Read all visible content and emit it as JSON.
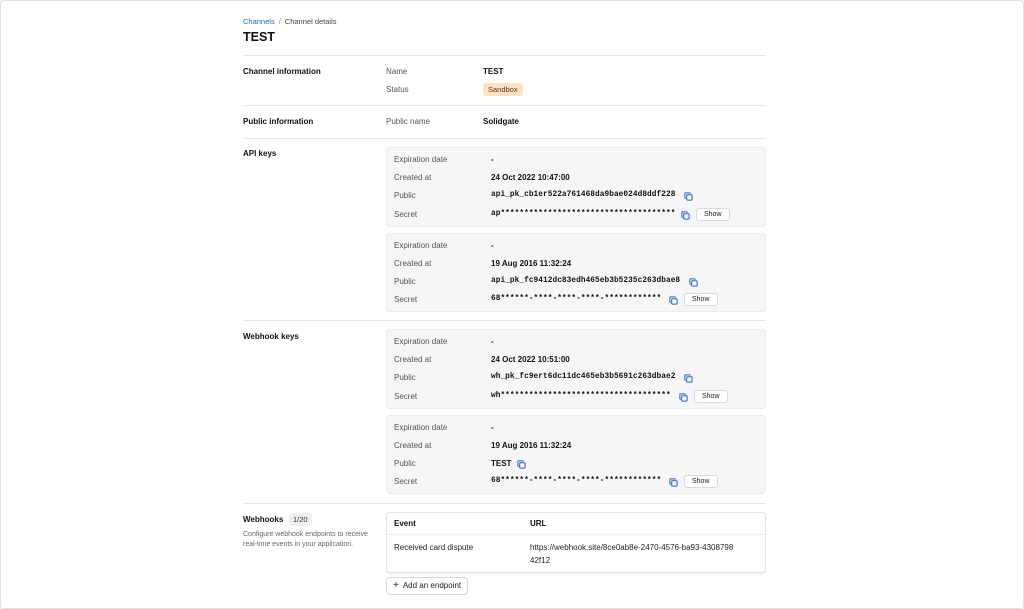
{
  "breadcrumb": {
    "root": "Channels",
    "current": "Channel details"
  },
  "page_title": "TEST",
  "channel_info": {
    "title": "Channel information",
    "name_label": "Name",
    "name_value": "TEST",
    "status_label": "Status",
    "status_value": "Sandbox"
  },
  "public_info": {
    "title": "Public information",
    "public_name_label": "Public name",
    "public_name_value": "Solidgate"
  },
  "labels": {
    "expiration": "Expiration date",
    "created": "Created at",
    "public": "Public",
    "secret": "Secret",
    "show": "Show"
  },
  "api_keys": {
    "title": "API keys",
    "keys": [
      {
        "expiration": "-",
        "created": "24 Oct 2022 10:47:00",
        "public": "api_pk_cb1er522a761468da9bae024d8ddf228",
        "secret": "ap*************************************"
      },
      {
        "expiration": "-",
        "created": "19 Aug 2016 11:32:24",
        "public": "api_pk_fc9412dc83edh465eb3b5235c263dbae8",
        "secret": "68******-****-****-****-************"
      }
    ]
  },
  "webhook_keys": {
    "title": "Webhook keys",
    "keys": [
      {
        "expiration": "-",
        "created": "24 Oct 2022 10:51:00",
        "public": "wh_pk_fc9ert6dc11dc465eb3b5691c263dbae2",
        "secret": "wh************************************"
      },
      {
        "expiration": "-",
        "created": "19 Aug 2016 11:32:24",
        "public": "TEST",
        "secret": "68******-****-****-****-************"
      }
    ]
  },
  "webhooks": {
    "title": "Webhooks",
    "count": "1/20",
    "description": "Configure webhook endpoints to receive real-time events in your application.",
    "columns": [
      "Event",
      "URL"
    ],
    "rows": [
      {
        "event": "Received card dispute",
        "url": "https://webhook.site/8ce0ab8e-2470-4576-ba93-430879842f12"
      }
    ],
    "add_label": "Add an endpoint"
  },
  "colors": {
    "link": "#1f63c9",
    "badge_bg": "#fde1c4",
    "copy_icon": "#1f63c9"
  }
}
